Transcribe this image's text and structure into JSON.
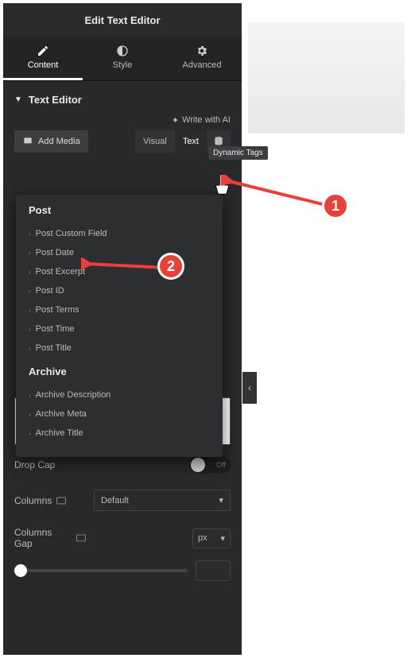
{
  "header": {
    "title": "Edit Text Editor"
  },
  "tabs": {
    "content": "Content",
    "style": "Style",
    "advanced": "Advanced"
  },
  "section": {
    "title": "Text Editor"
  },
  "ai": {
    "label": "Write with AI"
  },
  "toolbar": {
    "add_media": "Add Media",
    "visual": "Visual",
    "text": "Text"
  },
  "tooltip": {
    "dynamic_tags": "Dynamic Tags"
  },
  "dropdown": {
    "groups": [
      {
        "title": "Post",
        "items": [
          "Post Custom Field",
          "Post Date",
          "Post Excerpt",
          "Post ID",
          "Post Terms",
          "Post Time",
          "Post Title"
        ]
      },
      {
        "title": "Archive",
        "items": [
          "Archive Description",
          "Archive Meta",
          "Archive Title"
        ]
      }
    ]
  },
  "controls": {
    "drop_cap": "Drop Cap",
    "drop_cap_state": "Off",
    "columns": "Columns",
    "columns_value": "Default",
    "columns_gap": "Columns Gap",
    "gap_unit": "px"
  },
  "annotations": {
    "one": "1",
    "two": "2"
  },
  "collapse": {
    "label": "‹"
  }
}
